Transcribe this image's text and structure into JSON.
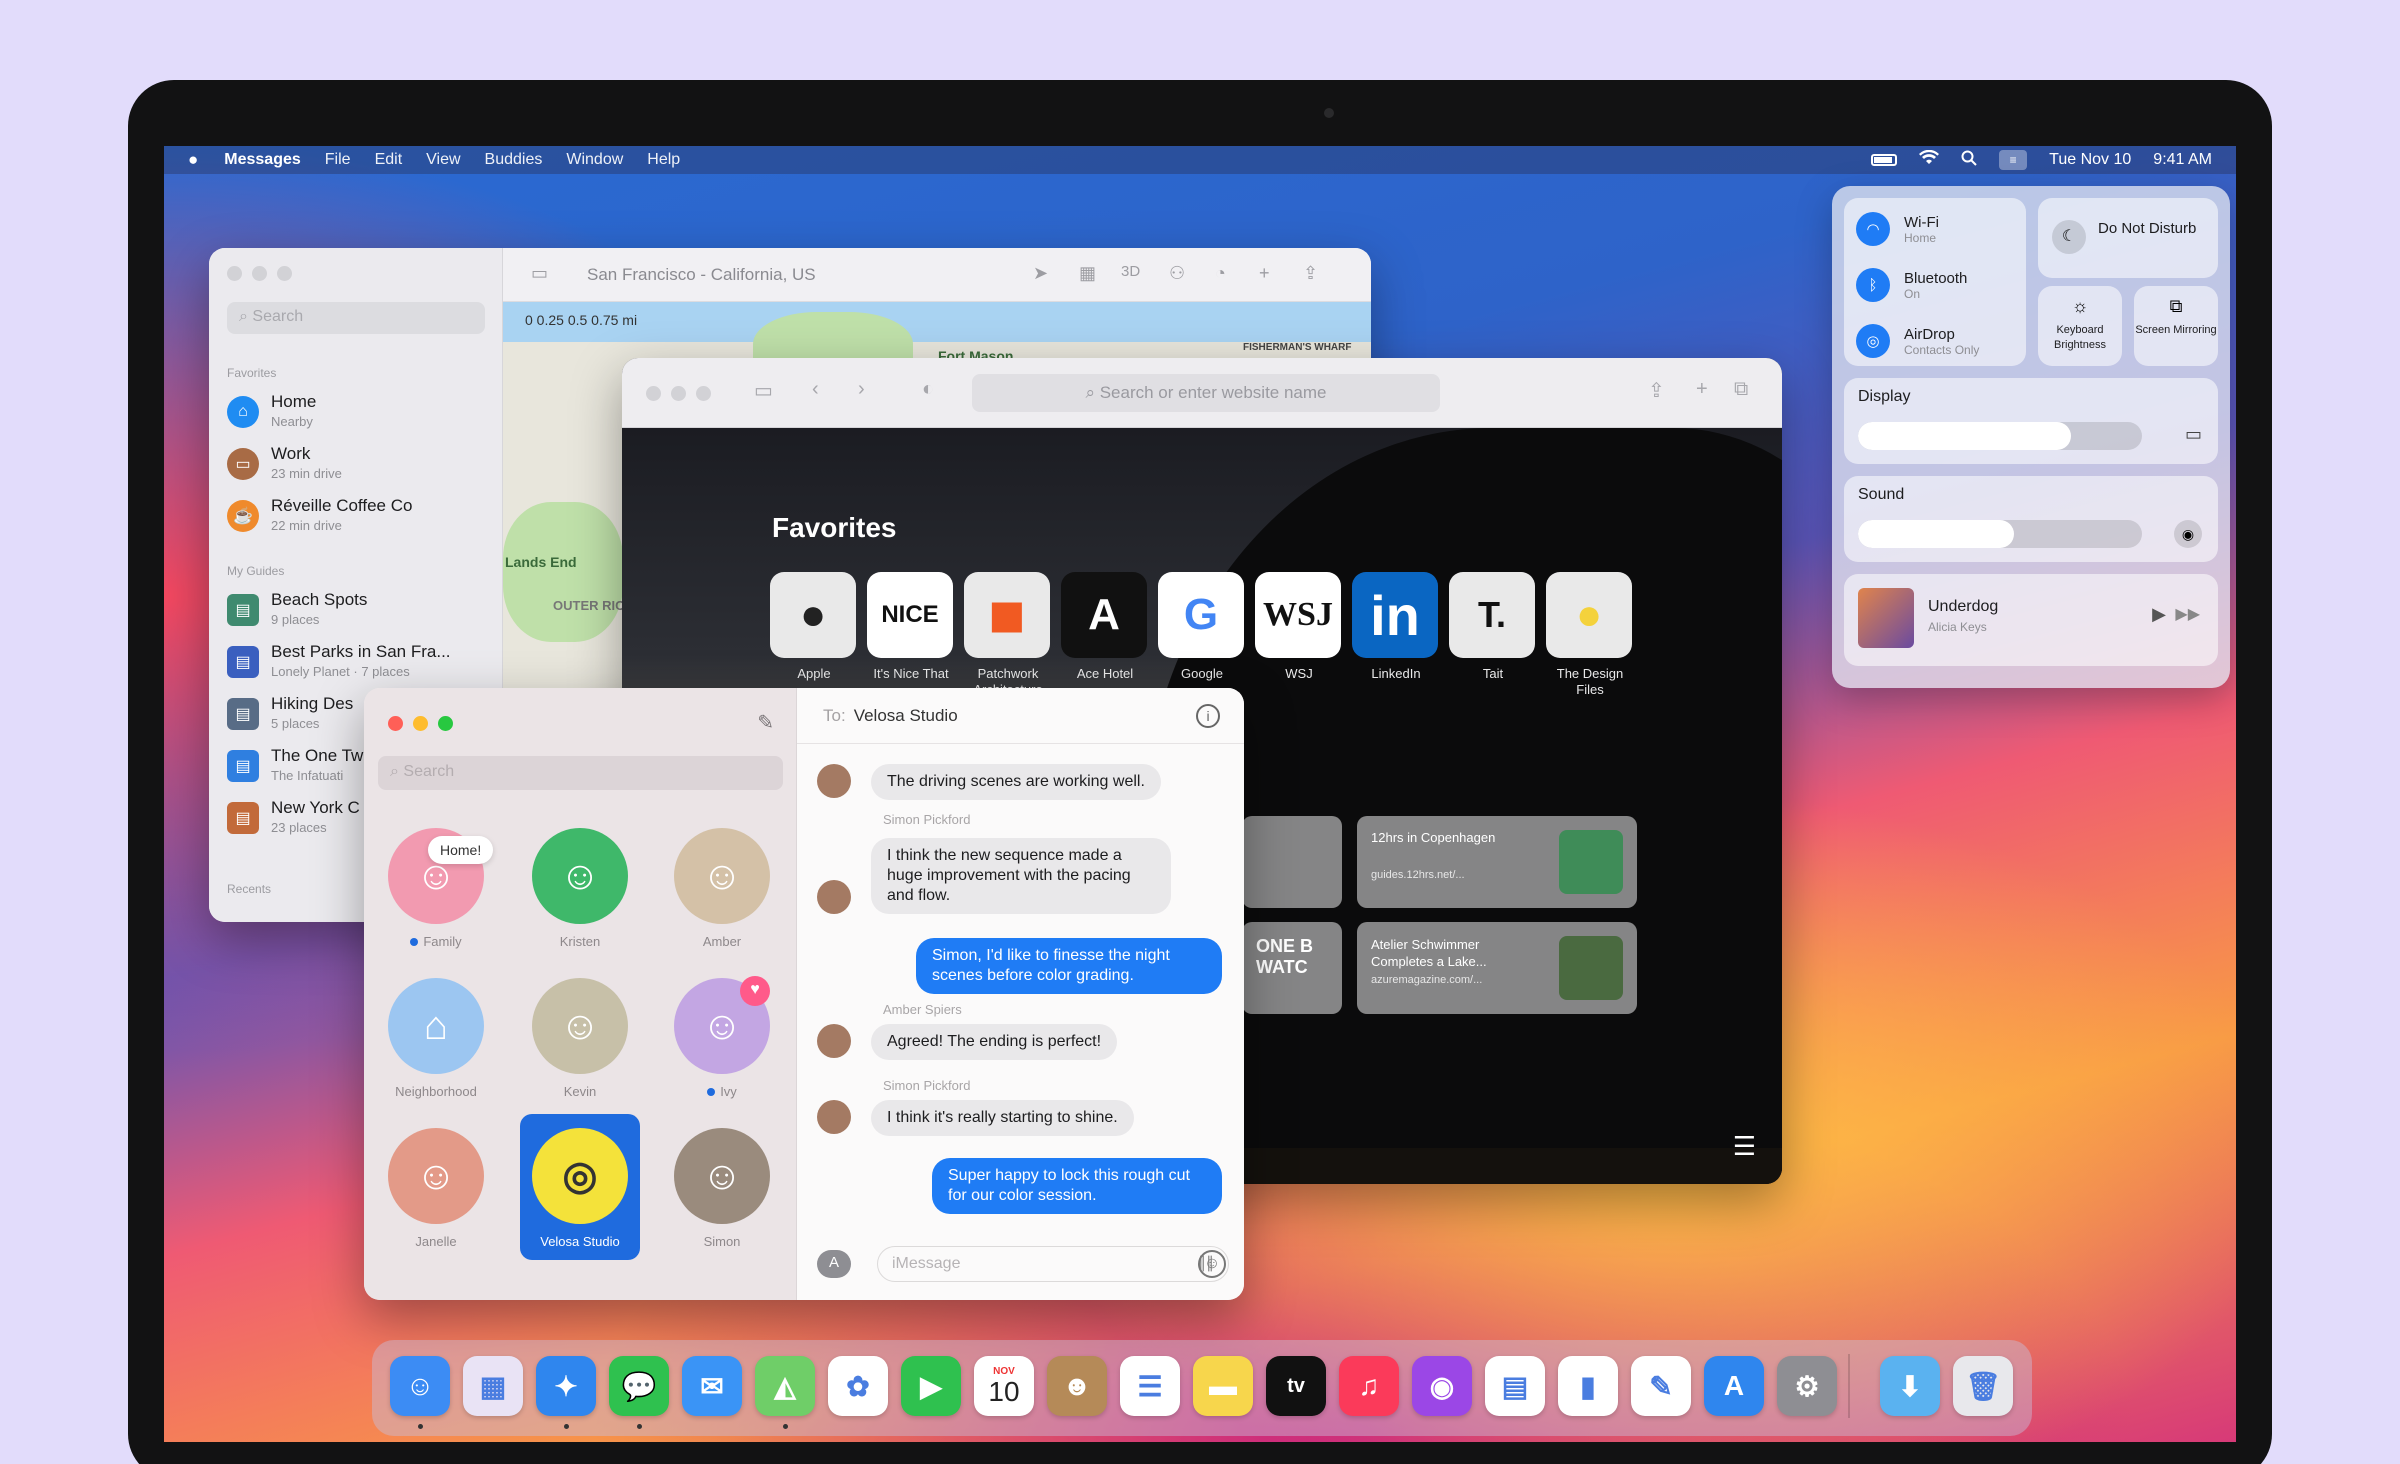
{
  "menubar": {
    "apple": "",
    "app": "Messages",
    "menus": [
      "File",
      "Edit",
      "View",
      "Buddies",
      "Window",
      "Help"
    ],
    "date": "Tue Nov 10",
    "time": "9:41 AM"
  },
  "maps": {
    "search_placeholder": "Search",
    "favorites_label": "Favorites",
    "favorites": [
      {
        "title": "Home",
        "subtitle": "Nearby",
        "color": "#1f8cf2",
        "icon": "⌂"
      },
      {
        "title": "Work",
        "subtitle": "23 min drive",
        "color": "#a86b45",
        "icon": "▭"
      },
      {
        "title": "Réveille Coffee Co",
        "subtitle": "22 min drive",
        "color": "#ef8a2c",
        "icon": "☕"
      }
    ],
    "guides_label": "My Guides",
    "guides": [
      {
        "title": "Beach Spots",
        "subtitle": "9 places",
        "color": "#3f8a6f"
      },
      {
        "title": "Best Parks in San Fra...",
        "subtitle": "Lonely Planet · 7 places",
        "color": "#3a5fbf"
      },
      {
        "title": "Hiking Des",
        "subtitle": "5 places",
        "color": "#586c86"
      },
      {
        "title": "The One Tw",
        "subtitle": "The Infatuati",
        "color": "#2f7fe0"
      },
      {
        "title": "New York C",
        "subtitle": "23 places",
        "color": "#c26a3a"
      }
    ],
    "recents_label": "Recents",
    "title": "San Francisco - California, US",
    "scale": "0    0.25   0.5   0.75 mi",
    "map_labels": [
      "Fort Mason",
      "FISHERMAN'S WHARF",
      "Lands End",
      "OUTER RICHMO"
    ],
    "toolbar_3d": "3D"
  },
  "safari": {
    "url_placeholder": "Search or enter website name",
    "favorites_title": "Favorites",
    "favorites": [
      {
        "label": "Apple",
        "glyph": "",
        "bg": "#e9e9e9",
        "fg": "#222"
      },
      {
        "label": "It's Nice That",
        "glyph": "NICE",
        "bg": "#ffffff",
        "fg": "#111"
      },
      {
        "label": "Patchwork Architecture",
        "glyph": "■",
        "bg": "#e9e9e9",
        "fg": "#f15a22"
      },
      {
        "label": "Ace Hotel",
        "glyph": "A",
        "bg": "#111111",
        "fg": "#fff"
      },
      {
        "label": "Google",
        "glyph": "G",
        "bg": "#ffffff",
        "fg": "#4285f4"
      },
      {
        "label": "WSJ",
        "glyph": "WSJ",
        "bg": "#ffffff",
        "fg": "#111"
      },
      {
        "label": "LinkedIn",
        "glyph": "in",
        "bg": "#0a66c2",
        "fg": "#fff"
      },
      {
        "label": "Tait",
        "glyph": "T.",
        "bg": "#e9e9e9",
        "fg": "#111"
      },
      {
        "label": "The Design Files",
        "glyph": "●",
        "bg": "#e9e9e9",
        "fg": "#f4d23c"
      }
    ],
    "cards": [
      {
        "title": "12hrs in Copenhagen",
        "sub": "guides.12hrs.net/..."
      },
      {
        "title": "Atelier Schwimmer Completes a Lake...",
        "sub": "azuremagazine.com/..."
      }
    ],
    "card_left_text": "ONE B WATC"
  },
  "messages": {
    "search_placeholder": "Search",
    "pins": [
      {
        "name": "Family",
        "color": "#f29ab0",
        "dot": true
      },
      {
        "name": "Kristen",
        "color": "#3fb86a"
      },
      {
        "name": "Amber",
        "color": "#d4c1a7"
      },
      {
        "name": "Neighborhood",
        "color": "#9cc6f1"
      },
      {
        "name": "Kevin",
        "color": "#c7c0a8"
      },
      {
        "name": "Ivy",
        "color": "#c3a6e3",
        "dot": true
      },
      {
        "name": "Janelle",
        "color": "#e39a88"
      },
      {
        "name": "Velosa Studio",
        "color": "#f4e23a"
      },
      {
        "name": "Simon",
        "color": "#9a8b7d"
      }
    ],
    "home_tag": "Home!",
    "to_label": "To:",
    "to_name": "Velosa Studio",
    "thread": [
      {
        "type": "in",
        "text": "The driving scenes are working well."
      },
      {
        "type": "sender",
        "text": "Simon Pickford"
      },
      {
        "type": "in",
        "text": "I think the new sequence made a huge improvement with the pacing and flow."
      },
      {
        "type": "out",
        "text": "Simon, I'd like to finesse the night scenes before color grading."
      },
      {
        "type": "sender",
        "text": "Amber Spiers"
      },
      {
        "type": "in",
        "text": "Agreed! The ending is perfect!"
      },
      {
        "type": "sender",
        "text": "Simon Pickford"
      },
      {
        "type": "in",
        "text": "I think it's really starting to shine."
      },
      {
        "type": "out",
        "text": "Super happy to lock this rough cut for our color session."
      }
    ],
    "compose_placeholder": "iMessage"
  },
  "control_center": {
    "wifi": {
      "title": "Wi-Fi",
      "sub": "Home"
    },
    "bluetooth": {
      "title": "Bluetooth",
      "sub": "On"
    },
    "airdrop": {
      "title": "AirDrop",
      "sub": "Contacts Only"
    },
    "dnd": "Do Not Disturb",
    "keyboard": "Keyboard Brightness",
    "mirroring": "Screen Mirroring",
    "display_label": "Display",
    "display_level": 0.75,
    "sound_label": "Sound",
    "sound_level": 0.55,
    "now_playing": {
      "title": "Underdog",
      "artist": "Alicia Keys"
    }
  },
  "dock": {
    "calendar_month": "NOV",
    "calendar_day": "10",
    "apps": [
      {
        "name": "finder-icon",
        "bg": "#3c8cf4",
        "glyph": "☺"
      },
      {
        "name": "launchpad-icon",
        "bg": "#e9e3f5",
        "glyph": "▦"
      },
      {
        "name": "safari-icon",
        "bg": "#2f86ee",
        "glyph": "✦"
      },
      {
        "name": "messages-icon",
        "bg": "#2fc14f",
        "glyph": "💬"
      },
      {
        "name": "mail-icon",
        "bg": "#3a94f6",
        "glyph": "✉"
      },
      {
        "name": "maps-icon",
        "bg": "#6fce68",
        "glyph": "◭"
      },
      {
        "name": "photos-icon",
        "bg": "#ffffff",
        "glyph": "✿"
      },
      {
        "name": "facetime-icon",
        "bg": "#2fc14f",
        "glyph": "▶"
      },
      {
        "name": "calendar-icon",
        "bg": "#ffffff",
        "glyph": ""
      },
      {
        "name": "contacts-icon",
        "bg": "#b58a58",
        "glyph": "☻"
      },
      {
        "name": "reminders-icon",
        "bg": "#ffffff",
        "glyph": "☰"
      },
      {
        "name": "notes-icon",
        "bg": "#f7d64c",
        "glyph": "▬"
      },
      {
        "name": "tv-icon",
        "bg": "#111111",
        "glyph": "tv"
      },
      {
        "name": "music-icon",
        "bg": "#fb3a5a",
        "glyph": "♫"
      },
      {
        "name": "podcasts-icon",
        "bg": "#9b47e6",
        "glyph": "◉"
      },
      {
        "name": "keynote-icon",
        "bg": "#ffffff",
        "glyph": "▤"
      },
      {
        "name": "numbers-icon",
        "bg": "#ffffff",
        "glyph": "▮"
      },
      {
        "name": "pages-icon",
        "bg": "#ffffff",
        "glyph": "✎"
      },
      {
        "name": "app-store-icon",
        "bg": "#2f86ee",
        "glyph": "A"
      },
      {
        "name": "system-preferences-icon",
        "bg": "#8e8e93",
        "glyph": "⚙"
      },
      {
        "name": "downloads-folder-icon",
        "bg": "#5ab2f0",
        "glyph": "⬇"
      },
      {
        "name": "trash-icon",
        "bg": "#e8e8ec",
        "glyph": "🗑"
      }
    ]
  }
}
